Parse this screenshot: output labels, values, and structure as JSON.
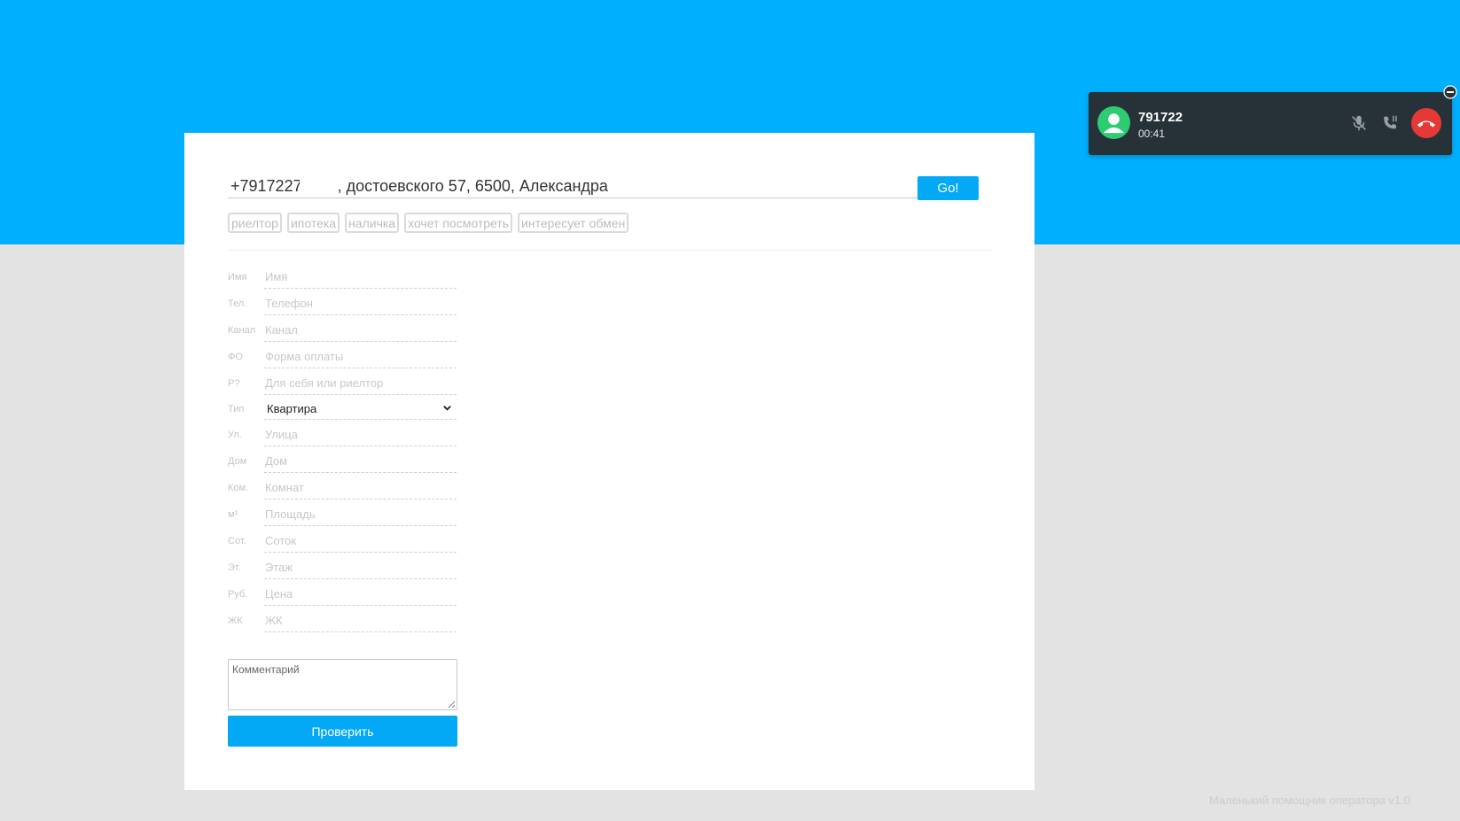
{
  "quick_input": {
    "value": "+7917227        , достоевского 57, 6500, Александра",
    "go_label": "Go!"
  },
  "tags": [
    "риелтор",
    "ипотека",
    "наличка",
    "хочет посмотреть",
    "интересует обмен"
  ],
  "form": {
    "fields": [
      {
        "label": "Имя",
        "placeholder": "Имя"
      },
      {
        "label": "Тел.",
        "placeholder": "Телефон"
      },
      {
        "label": "Канал",
        "placeholder": "Канал"
      },
      {
        "label": "ФО",
        "placeholder": "Форма оплаты"
      },
      {
        "label": "Р?",
        "placeholder": "Для себя или риелтор"
      },
      {
        "label": "Тип",
        "selected": "Квартира"
      },
      {
        "label": "Ул.",
        "placeholder": "Улица"
      },
      {
        "label": "Дом",
        "placeholder": "Дом"
      },
      {
        "label": "Ком.",
        "placeholder": "Комнат"
      },
      {
        "label": "м²",
        "placeholder": "Площадь"
      },
      {
        "label": "Сот.",
        "placeholder": "Соток"
      },
      {
        "label": "Эт.",
        "placeholder": "Этаж"
      },
      {
        "label": "Руб.",
        "placeholder": "Цена"
      },
      {
        "label": "ЖК",
        "placeholder": "ЖК"
      }
    ],
    "comment_placeholder": "Комментарий",
    "submit_label": "Проверить"
  },
  "call": {
    "number": "791722",
    "timer": "00:41"
  },
  "footer": "Маленький помощник оператора v1.0",
  "colors": {
    "accent": "#00b0ff",
    "button": "#03a9f4",
    "call_bg": "#263238",
    "hangup": "#e53935",
    "avatar": "#2ecc71"
  },
  "icons": [
    "user-avatar-icon",
    "mic-off-icon",
    "phone-transfer-icon",
    "hangup-icon",
    "minus-circle-icon",
    "chevron-down-icon",
    "resize-grip-icon"
  ]
}
